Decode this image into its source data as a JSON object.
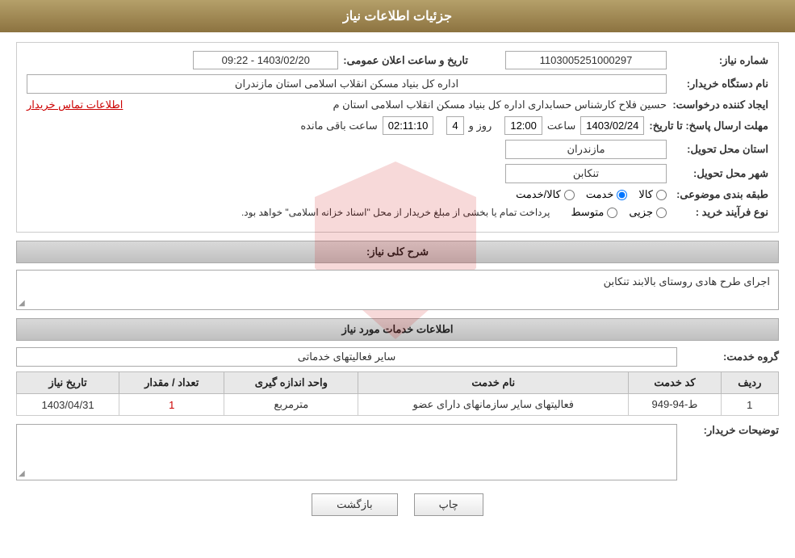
{
  "header": {
    "title": "جزئیات اطلاعات نیاز"
  },
  "fields": {
    "need_number_label": "شماره نیاز:",
    "need_number_value": "1103005251000297",
    "date_label": "تاریخ و ساعت اعلان عمومی:",
    "date_value": "1403/02/20 - 09:22",
    "buyer_label": "نام دستگاه خریدار:",
    "buyer_value": "اداره کل بنیاد مسکن انقلاب اسلامی استان مازندران",
    "creator_label": "ایجاد کننده درخواست:",
    "creator_name": "حسین فلاح کارشناس حسابداری اداره کل بنیاد مسکن انقلاب اسلامی استان م",
    "creator_link": "اطلاعات تماس خریدار",
    "deadline_label": "مهلت ارسال پاسخ: تا تاریخ:",
    "deadline_date": "1403/02/24",
    "deadline_time_label": "ساعت",
    "deadline_time": "12:00",
    "deadline_days_label": "روز و",
    "deadline_days": "4",
    "deadline_remaining_label": "ساعت باقی مانده",
    "deadline_remaining": "02:11:10",
    "province_label": "استان محل تحویل:",
    "province_value": "مازندران",
    "city_label": "شهر محل تحویل:",
    "city_value": "تنکابن",
    "category_label": "طبقه بندی موضوعی:",
    "category_options": [
      "کالا",
      "خدمت",
      "کالا/خدمت"
    ],
    "category_selected": "خدمت",
    "purchase_type_label": "نوع فرآیند خرید :",
    "purchase_type_options": [
      "جزیی",
      "متوسط"
    ],
    "purchase_type_note": "پرداخت تمام یا بخشی از مبلغ خریدار از محل \"اسناد خزانه اسلامی\" خواهد بود.",
    "description_label": "شرح کلی نیاز:",
    "description_value": "اجرای طرح هادی روستای بالابند تنکابن",
    "services_label": "اطلاعات خدمات مورد نیاز",
    "service_group_label": "گروه خدمت:",
    "service_group_value": "سایر فعالیتهای خدماتی",
    "table": {
      "headers": [
        "ردیف",
        "کد خدمت",
        "نام خدمت",
        "واحد اندازه گیری",
        "تعداد / مقدار",
        "تاریخ نیاز"
      ],
      "rows": [
        {
          "row": "1",
          "code": "ط-94-949",
          "name": "فعالیتهای سایر سازمانهای دارای عضو",
          "unit": "مترمربع",
          "quantity": "1",
          "date": "1403/04/31"
        }
      ]
    },
    "buyer_notes_label": "توضیحات خریدار:",
    "buyer_notes_value": ""
  },
  "buttons": {
    "print_label": "چاپ",
    "back_label": "بازگشت"
  }
}
